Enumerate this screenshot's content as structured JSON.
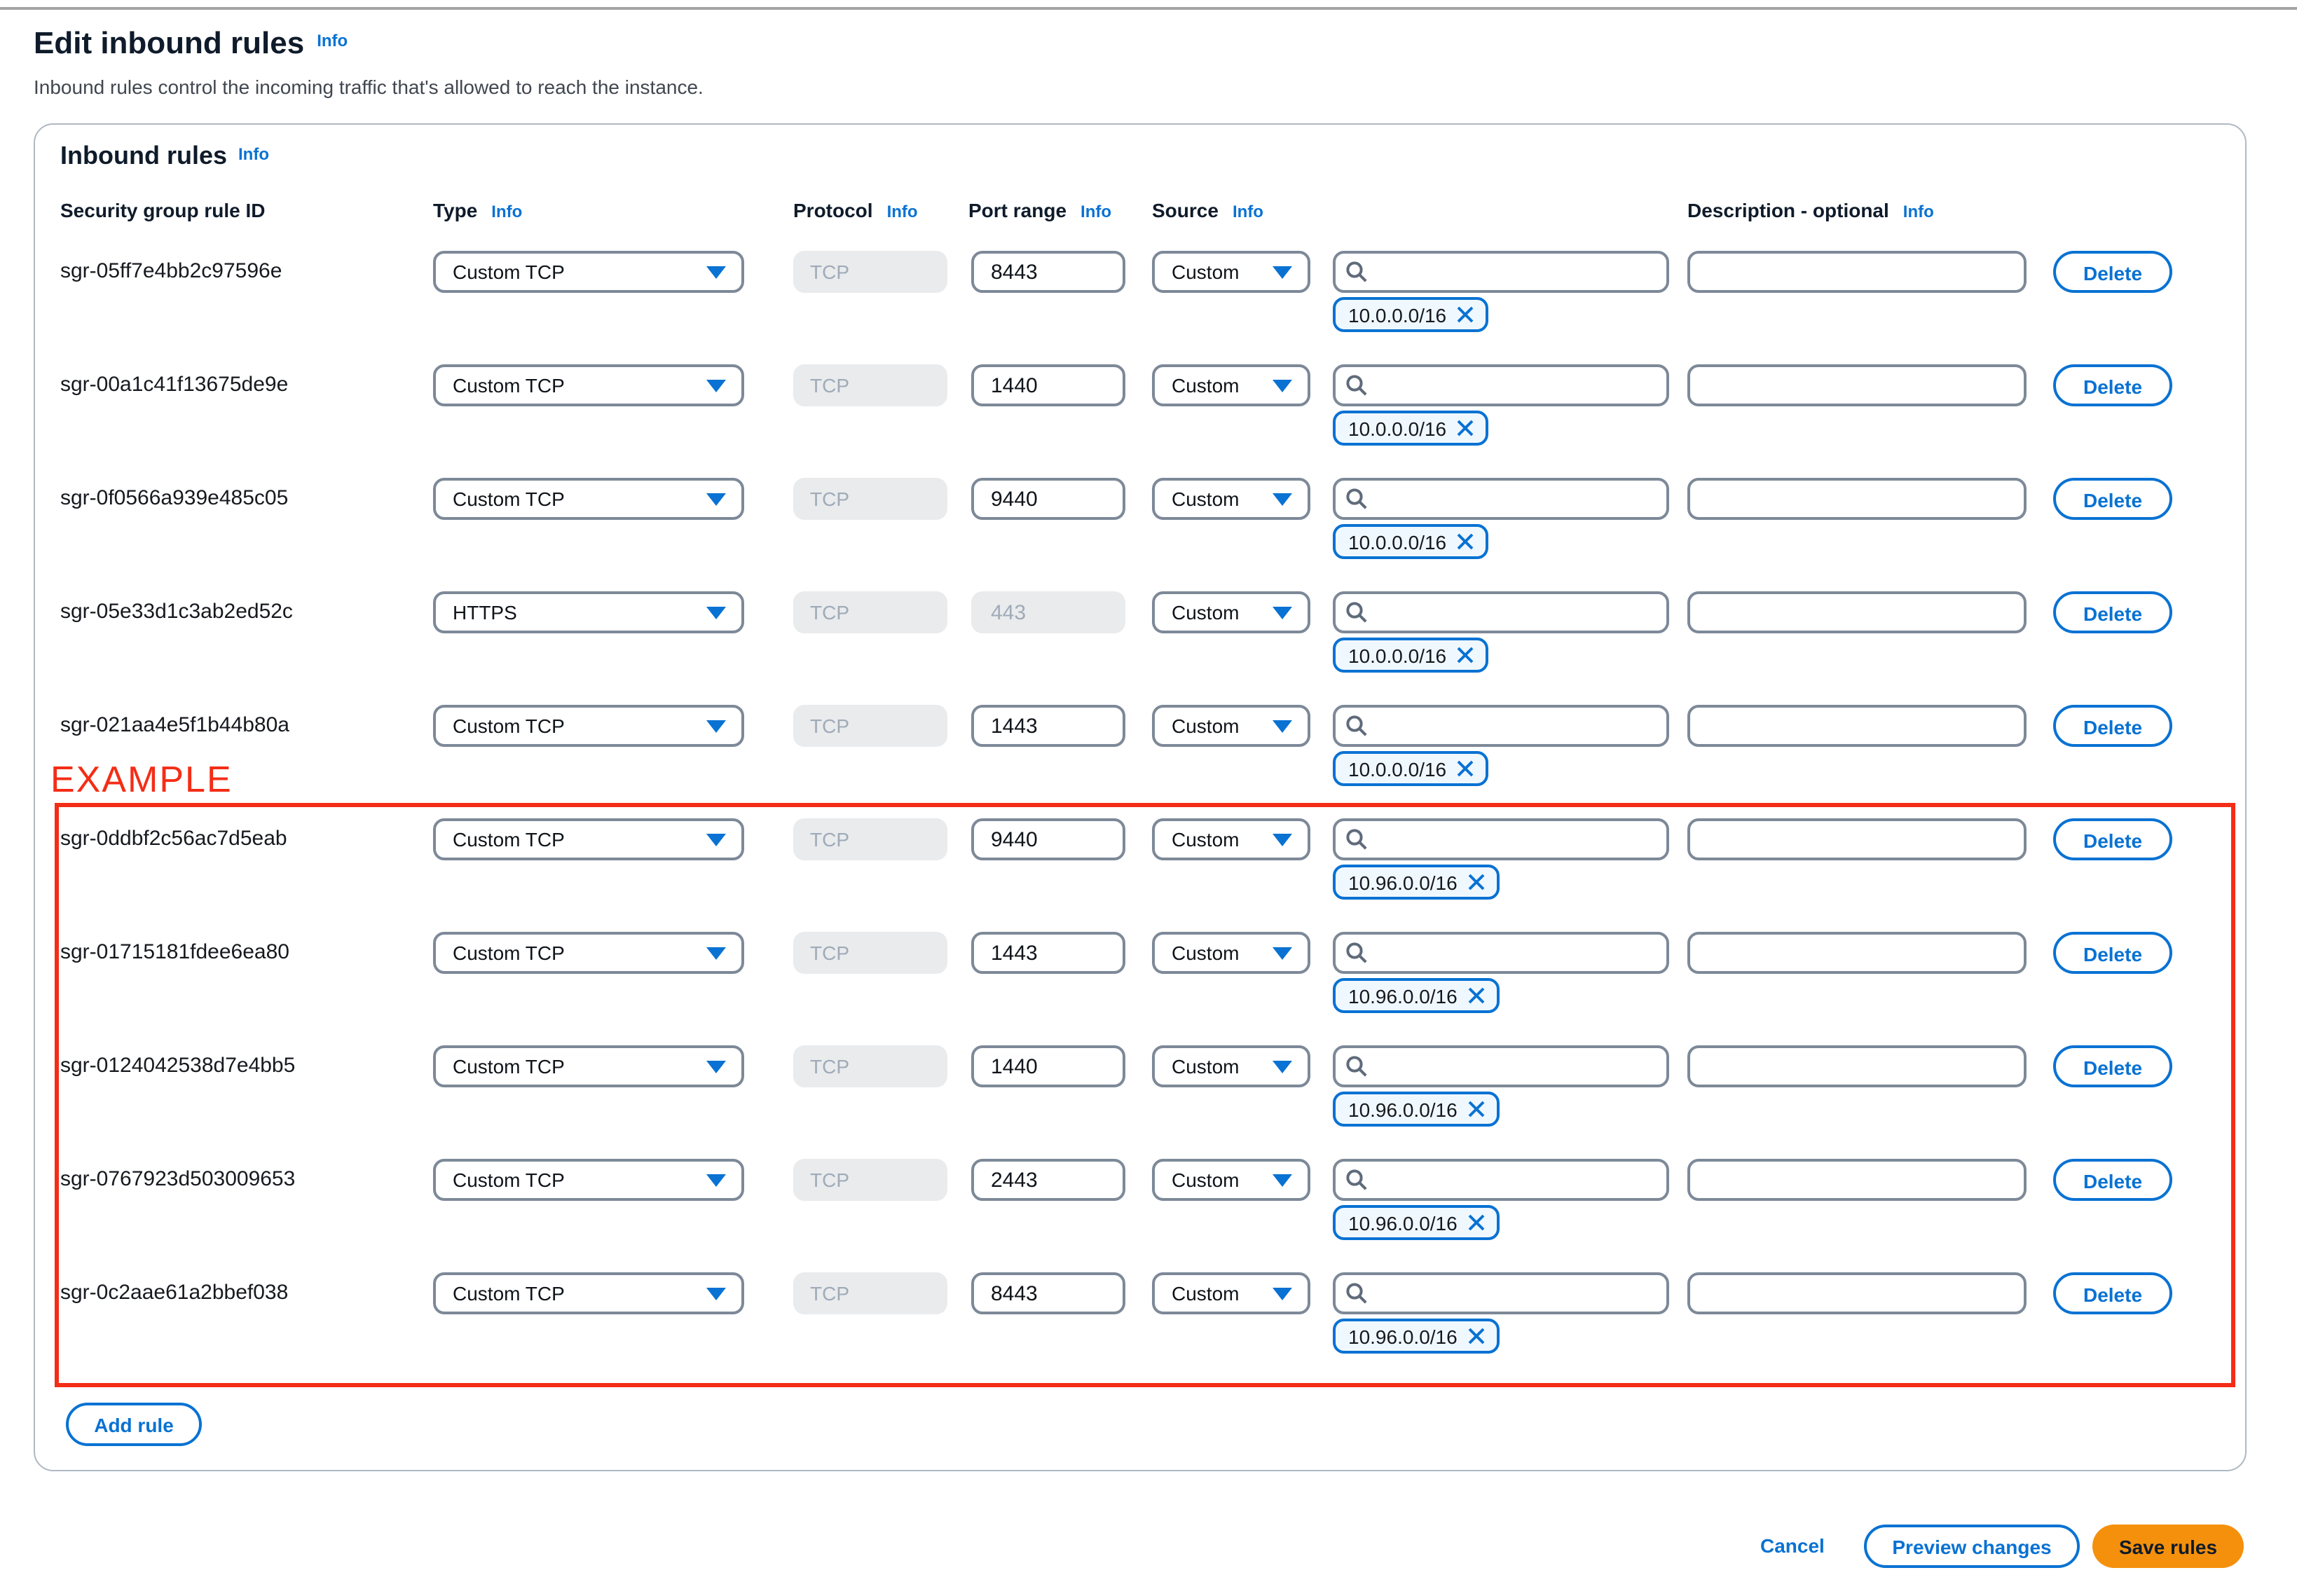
{
  "page": {
    "title": "Edit inbound rules",
    "title_info": "Info",
    "subtitle": "Inbound rules control the incoming traffic that's allowed to reach the instance."
  },
  "panel": {
    "heading": "Inbound rules",
    "heading_info": "Info",
    "columns": {
      "id": "Security group rule ID",
      "type": "Type",
      "protocol": "Protocol",
      "port": "Port range",
      "source": "Source",
      "description": "Description - optional",
      "info": "Info"
    },
    "rows": [
      {
        "id": "sgr-05ff7e4bb2c97596e",
        "type": "Custom TCP",
        "protocol": "TCP",
        "port": "8443",
        "port_disabled": false,
        "source": "Custom",
        "cidr": "10.0.0.0/16"
      },
      {
        "id": "sgr-00a1c41f13675de9e",
        "type": "Custom TCP",
        "protocol": "TCP",
        "port": "1440",
        "port_disabled": false,
        "source": "Custom",
        "cidr": "10.0.0.0/16"
      },
      {
        "id": "sgr-0f0566a939e485c05",
        "type": "Custom TCP",
        "protocol": "TCP",
        "port": "9440",
        "port_disabled": false,
        "source": "Custom",
        "cidr": "10.0.0.0/16"
      },
      {
        "id": "sgr-05e33d1c3ab2ed52c",
        "type": "HTTPS",
        "protocol": "TCP",
        "port": "443",
        "port_disabled": true,
        "source": "Custom",
        "cidr": "10.0.0.0/16"
      },
      {
        "id": "sgr-021aa4e5f1b44b80a",
        "type": "Custom TCP",
        "protocol": "TCP",
        "port": "1443",
        "port_disabled": false,
        "source": "Custom",
        "cidr": "10.0.0.0/16"
      },
      {
        "id": "sgr-0ddbf2c56ac7d5eab",
        "type": "Custom TCP",
        "protocol": "TCP",
        "port": "9440",
        "port_disabled": false,
        "source": "Custom",
        "cidr": "10.96.0.0/16"
      },
      {
        "id": "sgr-01715181fdee6ea80",
        "type": "Custom TCP",
        "protocol": "TCP",
        "port": "1443",
        "port_disabled": false,
        "source": "Custom",
        "cidr": "10.96.0.0/16"
      },
      {
        "id": "sgr-0124042538d7e4bb5",
        "type": "Custom TCP",
        "protocol": "TCP",
        "port": "1440",
        "port_disabled": false,
        "source": "Custom",
        "cidr": "10.96.0.0/16"
      },
      {
        "id": "sgr-0767923d503009653",
        "type": "Custom TCP",
        "protocol": "TCP",
        "port": "2443",
        "port_disabled": false,
        "source": "Custom",
        "cidr": "10.96.0.0/16"
      },
      {
        "id": "sgr-0c2aae61a2bbef038",
        "type": "Custom TCP",
        "protocol": "TCP",
        "port": "8443",
        "port_disabled": false,
        "source": "Custom",
        "cidr": "10.96.0.0/16"
      }
    ],
    "delete_label": "Delete",
    "add_rule_label": "Add rule"
  },
  "annotation": {
    "label": "EXAMPLE",
    "red": "#f42d16"
  },
  "footer": {
    "cancel": "Cancel",
    "preview": "Preview changes",
    "save": "Save rules"
  },
  "colors": {
    "accent_blue": "#0972d3",
    "save_orange": "#f5900c",
    "border_gray": "#7d8998",
    "disabled_bg": "#e9ebed"
  }
}
